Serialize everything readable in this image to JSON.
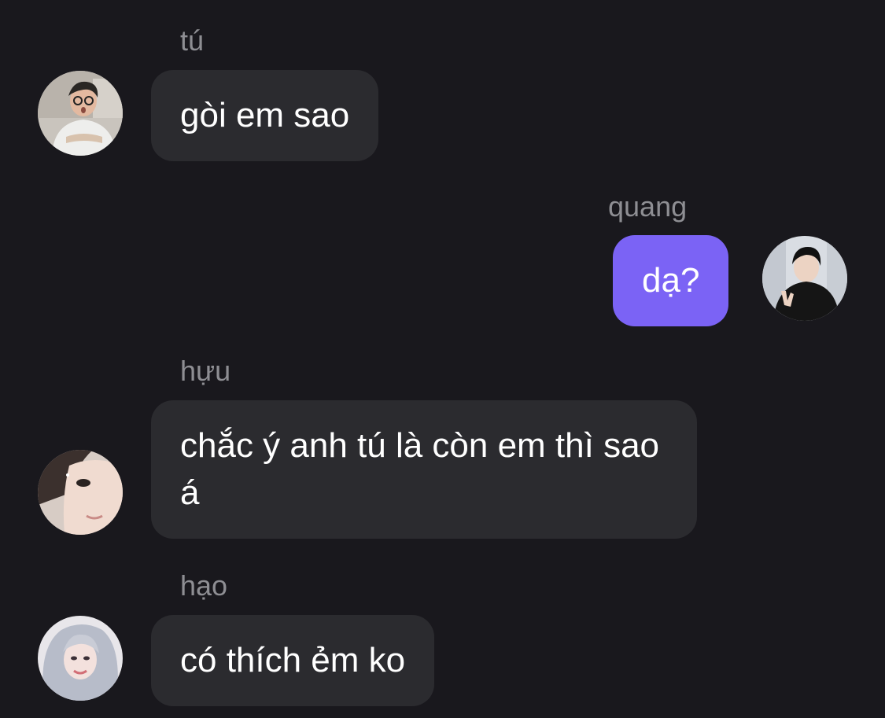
{
  "messages": [
    {
      "sender": "tú",
      "text": "gòi em sao",
      "outgoing": false,
      "avatar_icon": "avatar-tu-icon"
    },
    {
      "sender": "quang",
      "text": "dạ?",
      "outgoing": true,
      "avatar_icon": "avatar-quang-icon",
      "bubble_color": "#7b63f5"
    },
    {
      "sender": "hựu",
      "text": "chắc ý anh tú là còn em thì sao á",
      "outgoing": false,
      "avatar_icon": "avatar-huu-icon"
    },
    {
      "sender": "hạo",
      "text": "có thích ẻm ko",
      "outgoing": false,
      "avatar_icon": "avatar-hao-icon"
    }
  ],
  "colors": {
    "background": "#19181d",
    "incoming_bubble": "#2b2b2f",
    "outgoing_bubble": "#7b63f5",
    "sender_name": "#8e8e93"
  }
}
